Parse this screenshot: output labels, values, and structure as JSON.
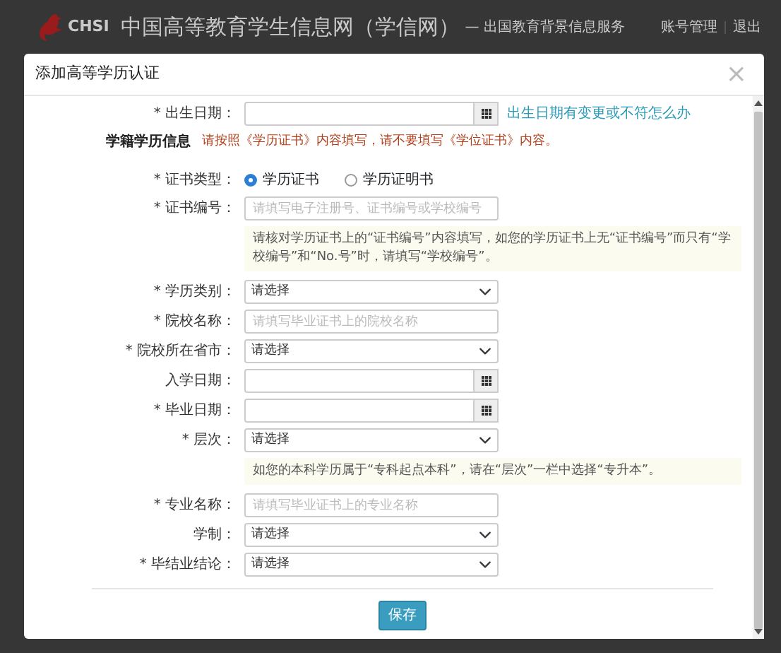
{
  "header": {
    "logo_text": "CHSI",
    "site_title": "中国高等教育学生信息网（学信网）",
    "subtitle": "— 出国教育背景信息服务",
    "links": [
      "账号管理",
      "退出"
    ]
  },
  "modal": {
    "title": "添加高等学历认证",
    "close": "×",
    "items": [
      {
        "kind": "date",
        "label": "* 出生日期：",
        "link": "出生日期有变更或不符怎么办"
      },
      {
        "kind": "section",
        "label": "学籍学历信息",
        "note": "请按照《学历证书》内容填写，请不要填写《学位证书》内容。"
      },
      {
        "kind": "radio",
        "label": "* 证书类型：",
        "options": [
          {
            "label": "学历证书",
            "selected": true
          },
          {
            "label": "学历证明书",
            "selected": false
          }
        ]
      },
      {
        "kind": "text",
        "label": "* 证书编号：",
        "placeholder": "请填写电子注册号、证书编号或学校编号"
      },
      {
        "kind": "hint",
        "text": "请核对学历证书上的“证书编号”内容填写，如您的学历证书上无“证书编号”而只有“学校编号”和“No.号”时，请填写“学校编号”。"
      },
      {
        "kind": "select",
        "label": "* 学历类别：",
        "value": "请选择"
      },
      {
        "kind": "text",
        "label": "* 院校名称：",
        "placeholder": "请填写毕业证书上的院校名称"
      },
      {
        "kind": "select",
        "label": "* 院校所在省市：",
        "value": "请选择"
      },
      {
        "kind": "date",
        "label": "入学日期："
      },
      {
        "kind": "date",
        "label": "* 毕业日期："
      },
      {
        "kind": "select",
        "label": "* 层次：",
        "value": "请选择"
      },
      {
        "kind": "hint",
        "text": "如您的本科学历属于“专科起点本科”，请在“层次”一栏中选择“专升本”。"
      },
      {
        "kind": "text",
        "label": "* 专业名称：",
        "placeholder": "请填写毕业证书上的专业名称"
      },
      {
        "kind": "select",
        "label": "学制：",
        "value": "请选择"
      },
      {
        "kind": "select",
        "label": "* 毕结业结论：",
        "value": "请选择"
      }
    ],
    "save": "保存"
  }
}
